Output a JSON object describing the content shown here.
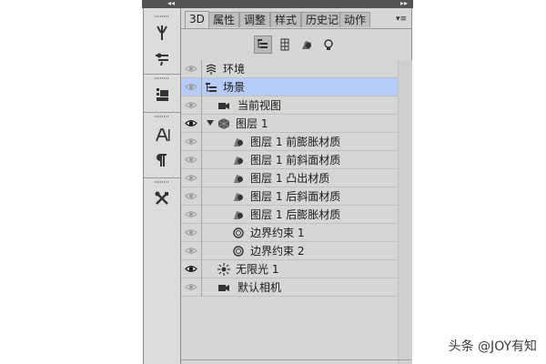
{
  "panel": {
    "collapse_left": "◂◂",
    "collapse_right": "▸▸",
    "menu": "▾≡",
    "tabs": [
      {
        "label": "3D",
        "active": true
      },
      {
        "label": "属性",
        "active": false
      },
      {
        "label": "调整",
        "active": false
      },
      {
        "label": "样式",
        "active": false
      },
      {
        "label": "历史记",
        "active": false
      },
      {
        "label": "动作",
        "active": false
      }
    ],
    "filters": [
      "whole-scene-filter",
      "mesh-filter",
      "material-filter",
      "light-filter"
    ]
  },
  "layers": [
    {
      "label": "环境",
      "icon": "environment-icon",
      "visible": false,
      "selected": false
    },
    {
      "label": "场景",
      "icon": "scene-icon",
      "visible": false,
      "selected": true
    },
    {
      "label": "当前视图",
      "icon": "camera-icon",
      "visible": false,
      "selected": false
    },
    {
      "label": "图层 1",
      "icon": "mesh-icon",
      "visible": true,
      "selected": false,
      "expanded": true
    },
    {
      "label": "图层 1 前膨胀材质",
      "icon": "material-icon",
      "visible": false,
      "selected": false
    },
    {
      "label": "图层 1 前斜面材质",
      "icon": "material-icon",
      "visible": false,
      "selected": false
    },
    {
      "label": "图层 1 凸出材质",
      "icon": "material-icon",
      "visible": false,
      "selected": false
    },
    {
      "label": "图层 1 后斜面材质",
      "icon": "material-icon",
      "visible": false,
      "selected": false
    },
    {
      "label": "图层 1 后膨胀材质",
      "icon": "material-icon",
      "visible": false,
      "selected": false
    },
    {
      "label": "边界约束 1",
      "icon": "constraint-icon",
      "visible": false,
      "selected": false
    },
    {
      "label": "边界约束 2",
      "icon": "constraint-icon",
      "visible": false,
      "selected": false
    },
    {
      "label": "无限光 1",
      "icon": "infinite-light-icon",
      "visible": true,
      "selected": false
    },
    {
      "label": "默认相机",
      "icon": "camera-icon",
      "visible": false,
      "selected": false
    }
  ],
  "watermark": "头条 @JOY有知",
  "colors": {
    "panel_bg": "#d6d6d6",
    "selected_row": "#b6cbf5",
    "dark_strip": "#535353"
  }
}
